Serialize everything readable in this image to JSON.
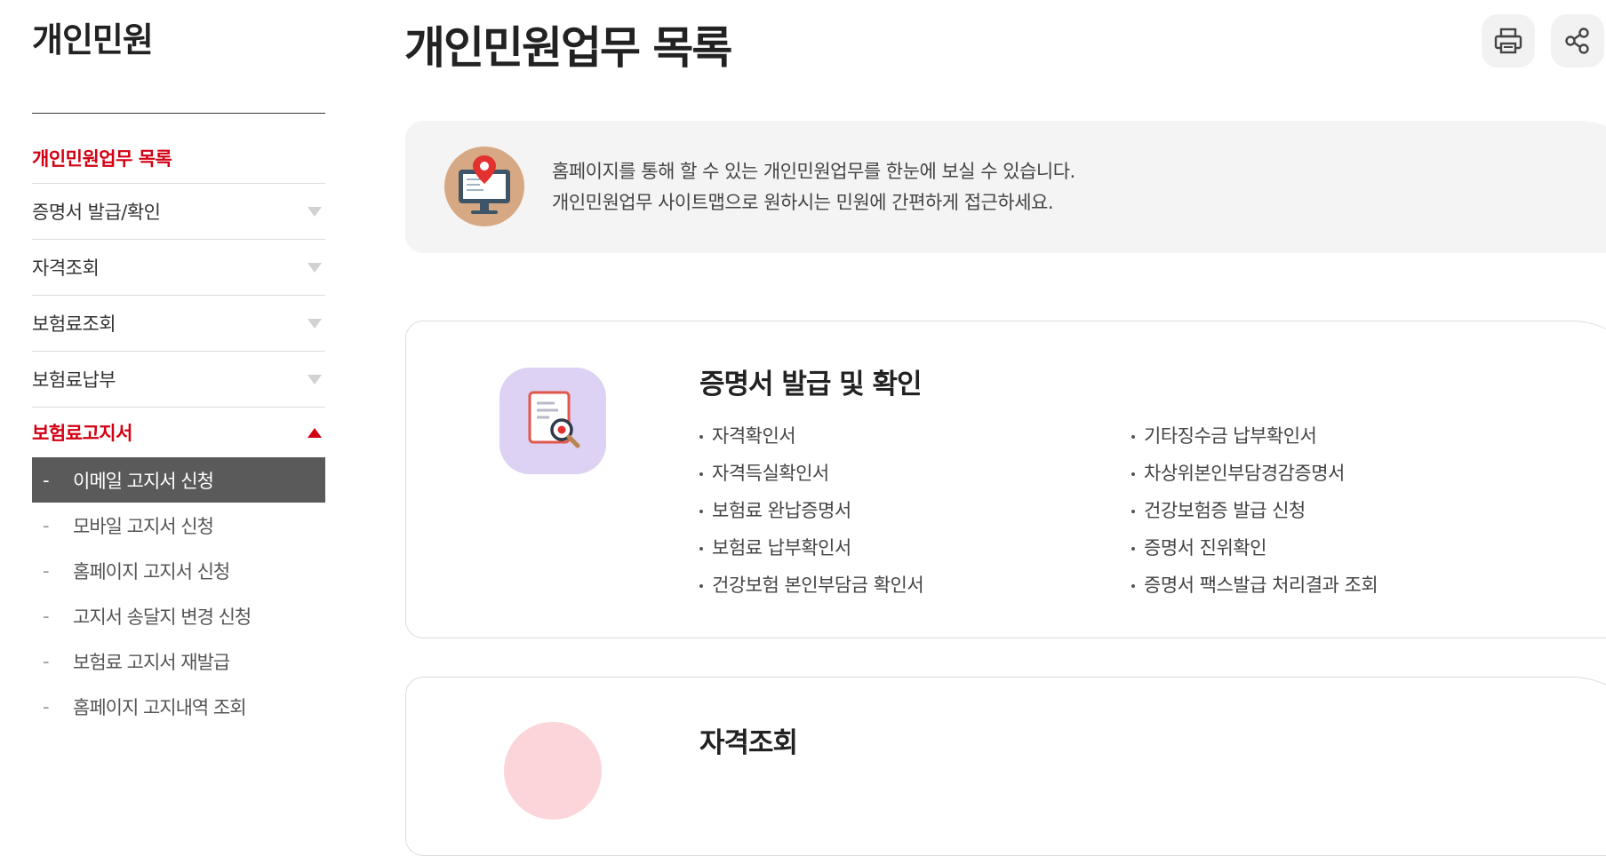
{
  "sidebar": {
    "title": "개인민원",
    "menu": [
      {
        "label": "개인민원업무 목록"
      },
      {
        "label": "증명서 발급/확인"
      },
      {
        "label": "자격조회"
      },
      {
        "label": "보험료조회"
      },
      {
        "label": "보험료납부"
      },
      {
        "label": "보험료고지서"
      }
    ],
    "submenu": [
      {
        "label": "이메일 고지서 신청"
      },
      {
        "label": "모바일 고지서 신청"
      },
      {
        "label": "홈페이지 고지서 신청"
      },
      {
        "label": "고지서 송달지 변경 신청"
      },
      {
        "label": "보험료 고지서 재발급"
      },
      {
        "label": "홈페이지 고지내역 조회"
      }
    ]
  },
  "main": {
    "title": "개인민원업무 목록",
    "intro": {
      "line1": "홈페이지를 통해 할 수 있는 개인민원업무를 한눈에 보실 수 있습니다.",
      "line2": "개인민원업무 사이트맵으로 원하시는 민원에 간편하게 접근하세요."
    },
    "cards": [
      {
        "title": "증명서 발급 및 확인",
        "left": [
          "자격확인서",
          "자격득실확인서",
          "보험료 완납증명서",
          "보험료 납부확인서",
          "건강보험 본인부담금 확인서"
        ],
        "right": [
          "기타징수금 납부확인서",
          "차상위본인부담경감증명서",
          "건강보험증 발급 신청",
          "증명서 진위확인",
          "증명서 팩스발급 처리결과 조회"
        ]
      },
      {
        "title": "자격조회"
      }
    ]
  },
  "colors": {
    "accent": "#d30013",
    "selected_bg": "#5a5a5a",
    "intro_bg": "#f4f4f4",
    "card1_icon_bg": "#ddd1f4",
    "card2_icon_bg": "#fbd5da"
  },
  "icons": {
    "print": "printer-icon",
    "share": "share-icon",
    "intro": "monitor-location-icon",
    "card1": "document-search-icon"
  }
}
